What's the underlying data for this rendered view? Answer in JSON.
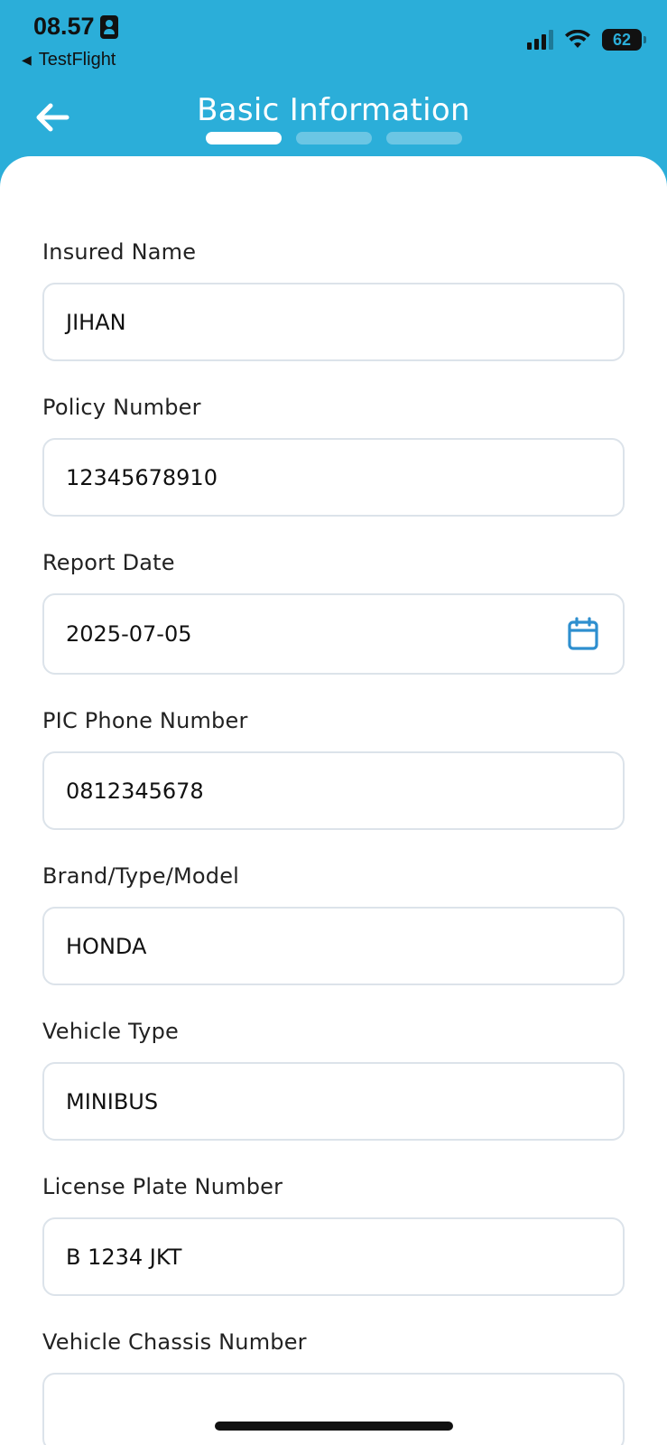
{
  "status_bar": {
    "time": "08.57",
    "back_app": "TestFlight",
    "battery": "62"
  },
  "header": {
    "title": "Basic Information",
    "steps_total": 3,
    "active_step": 1
  },
  "colors": {
    "header_bg": "#2BAED9",
    "accent": "#2E8FCF",
    "border": "#DCE3EA"
  },
  "form": {
    "insured_name": {
      "label": "Insured Name",
      "value": "JIHAN"
    },
    "policy_number": {
      "label": "Policy Number",
      "value": "12345678910"
    },
    "report_date": {
      "label": "Report Date",
      "value": "2025-07-05",
      "icon": "calendar-icon"
    },
    "pic_phone": {
      "label": "PIC Phone Number",
      "value": "0812345678"
    },
    "brand_model": {
      "label": "Brand/Type/Model",
      "value": "HONDA"
    },
    "vehicle_type": {
      "label": "Vehicle Type",
      "value": "MINIBUS"
    },
    "license_plate": {
      "label": "License Plate Number",
      "value": "B 1234 JKT"
    },
    "chassis_number": {
      "label": "Vehicle Chassis Number",
      "value": ""
    }
  }
}
